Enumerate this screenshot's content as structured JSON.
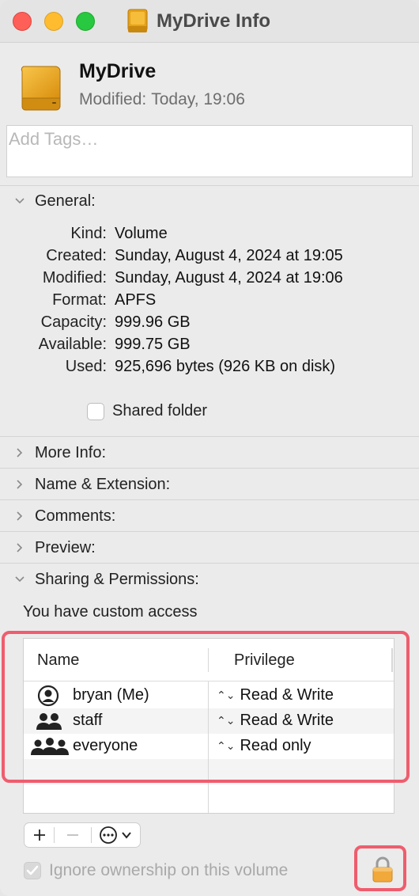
{
  "window": {
    "title": "MyDrive Info"
  },
  "header": {
    "name": "MyDrive",
    "modified_label": "Modified:",
    "modified_value": "Today, 19:06"
  },
  "tags": {
    "placeholder": "Add Tags…"
  },
  "general": {
    "title": "General:",
    "rows": [
      {
        "key": "Kind:",
        "value": "Volume"
      },
      {
        "key": "Created:",
        "value": "Sunday, August 4, 2024 at 19:05"
      },
      {
        "key": "Modified:",
        "value": "Sunday, August 4, 2024 at 19:06"
      },
      {
        "key": "Format:",
        "value": "APFS"
      },
      {
        "key": "Capacity:",
        "value": "999.96 GB"
      },
      {
        "key": "Available:",
        "value": "999.75 GB"
      },
      {
        "key": "Used:",
        "value": "925,696 bytes (926 KB on disk)"
      }
    ],
    "shared_folder_label": "Shared folder",
    "shared_folder_checked": false
  },
  "sections": {
    "more_info": "More Info:",
    "name_extension": "Name & Extension:",
    "comments": "Comments:",
    "preview": "Preview:",
    "sharing": "Sharing & Permissions:"
  },
  "sharing": {
    "access_text": "You have custom access",
    "columns": {
      "name": "Name",
      "privilege": "Privilege"
    },
    "rows": [
      {
        "icon": "single-user-icon",
        "user": "bryan (Me)",
        "privilege": "Read & Write"
      },
      {
        "icon": "group-icon",
        "user": "staff",
        "privilege": "Read & Write"
      },
      {
        "icon": "everyone-icon",
        "user": "everyone",
        "privilege": "Read only"
      }
    ],
    "ignore_ownership_label": "Ignore ownership on this volume",
    "ignore_ownership_checked": true,
    "ignore_ownership_enabled": false
  },
  "colors": {
    "highlight": "#ef5d6e",
    "drive": "#f0a81c"
  }
}
